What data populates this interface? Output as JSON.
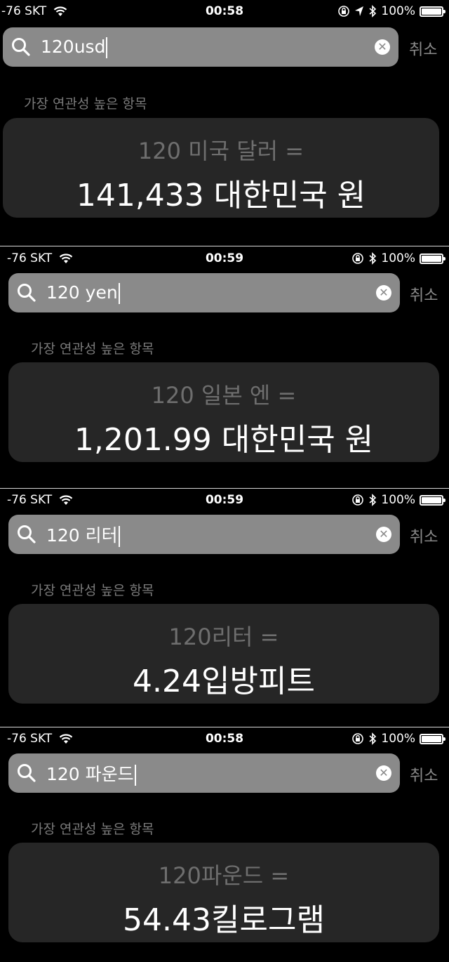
{
  "panels": [
    {
      "status": {
        "signal": "-76 SKT",
        "time": "00:58",
        "battery": "100%",
        "icons": [
          "wifi-icon",
          "orientation-lock-icon",
          "location-arrow-icon",
          "bluetooth-icon",
          "battery-icon"
        ]
      },
      "search": {
        "query": "120usd",
        "clear_icon": "clear-icon",
        "cancel": "취소"
      },
      "section_title": "가장 연관성 높은 항목",
      "card": {
        "expression": "120 미국 달러 =",
        "result": "141,433 대한민국 원"
      }
    },
    {
      "status": {
        "signal": "-76 SKT",
        "time": "00:59",
        "battery": "100%",
        "icons": [
          "wifi-icon",
          "orientation-lock-icon",
          "bluetooth-icon",
          "battery-icon"
        ]
      },
      "search": {
        "query": "120 yen",
        "clear_icon": "clear-icon",
        "cancel": "취소"
      },
      "section_title": "가장 연관성 높은 항목",
      "card": {
        "expression": "120 일본 엔 =",
        "result": "1,201.99 대한민국 원"
      }
    },
    {
      "status": {
        "signal": "-76 SKT",
        "time": "00:59",
        "battery": "100%",
        "icons": [
          "wifi-icon",
          "orientation-lock-icon",
          "bluetooth-icon",
          "battery-icon"
        ]
      },
      "search": {
        "query": "120 리터",
        "clear_icon": "clear-icon",
        "cancel": "취소"
      },
      "section_title": "가장 연관성 높은 항목",
      "card": {
        "expression": "120리터 =",
        "result": "4.24입방피트"
      }
    },
    {
      "status": {
        "signal": "-76 SKT",
        "time": "00:58",
        "battery": "100%",
        "icons": [
          "wifi-icon",
          "orientation-lock-icon",
          "bluetooth-icon",
          "battery-icon"
        ]
      },
      "search": {
        "query": "120 파운드",
        "clear_icon": "clear-icon",
        "cancel": "취소"
      },
      "section_title": "가장 연관성 높은 항목",
      "card": {
        "expression": "120파운드 =",
        "result": "54.43킬로그램"
      }
    }
  ]
}
